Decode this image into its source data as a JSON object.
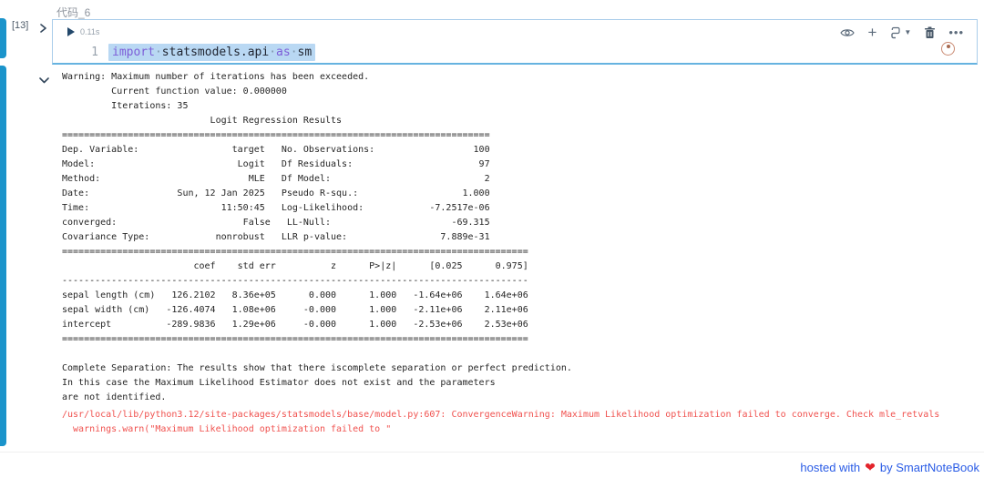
{
  "cell": {
    "title": "代码_6",
    "execution_count": "[13]",
    "runtime": "0.11s",
    "code": {
      "line_number": "1",
      "full_text": "import statsmodels.api as sm",
      "tokens": [
        {
          "text": "import",
          "type": "keyword"
        },
        {
          "text": "statsmodels.api",
          "type": "plain"
        },
        {
          "text": "as",
          "type": "keyword"
        },
        {
          "text": "sm",
          "type": "plain"
        }
      ]
    },
    "toolbar_icons": [
      "visibility-icon",
      "add-cell-icon",
      "python-env-icon",
      "delete-icon",
      "more-options-icon"
    ]
  },
  "output": {
    "text": "Warning: Maximum number of iterations has been exceeded.\n         Current function value: 0.000000\n         Iterations: 35\n                           Logit Regression Results\n==============================================================================\nDep. Variable:                 target   No. Observations:                  100\nModel:                          Logit   Df Residuals:                       97\nMethod:                           MLE   Df Model:                            2\nDate:                Sun, 12 Jan 2025   Pseudo R-squ.:                   1.000\nTime:                        11:50:45   Log-Likelihood:            -7.2517e-06\nconverged:                       False   LL-Null:                      -69.315\nCovariance Type:            nonrobust   LLR p-value:                 7.889e-31\n=====================================================================================\n                        coef    std err          z      P>|z|      [0.025      0.975]\n-------------------------------------------------------------------------------------\nsepal length (cm)   126.2102   8.36e+05      0.000      1.000   -1.64e+06    1.64e+06\nsepal width (cm)   -126.4074   1.08e+06     -0.000      1.000   -2.11e+06    2.11e+06\nintercept          -289.9836   1.29e+06     -0.000      1.000   -2.53e+06    2.53e+06\n=====================================================================================\n\nComplete Separation: The results show that there iscomplete separation or perfect prediction.\nIn this case the Maximum Likelihood Estimator does not exist and the parameters\nare not identified.",
    "stderr": "/usr/local/lib/python3.12/site-packages/statsmodels/base/model.py:607: ConvergenceWarning: Maximum Likelihood optimization failed to converge. Check mle_retvals\n  warnings.warn(\"Maximum Likelihood optimization failed to \""
  },
  "footer": {
    "prefix": "hosted with",
    "heart": "❤",
    "suffix": "by SmartNoteBook"
  },
  "colors": {
    "gutter_bar": "#1b94cb",
    "cell_border": "#aacdea",
    "selection": "#b9d8f3",
    "keyword": "#7d5ed8",
    "stderr_red": "#f0524f",
    "footer_blue": "#2a5ce6",
    "heart_red": "#e3242b",
    "kernel_ring": "#c98a72"
  }
}
